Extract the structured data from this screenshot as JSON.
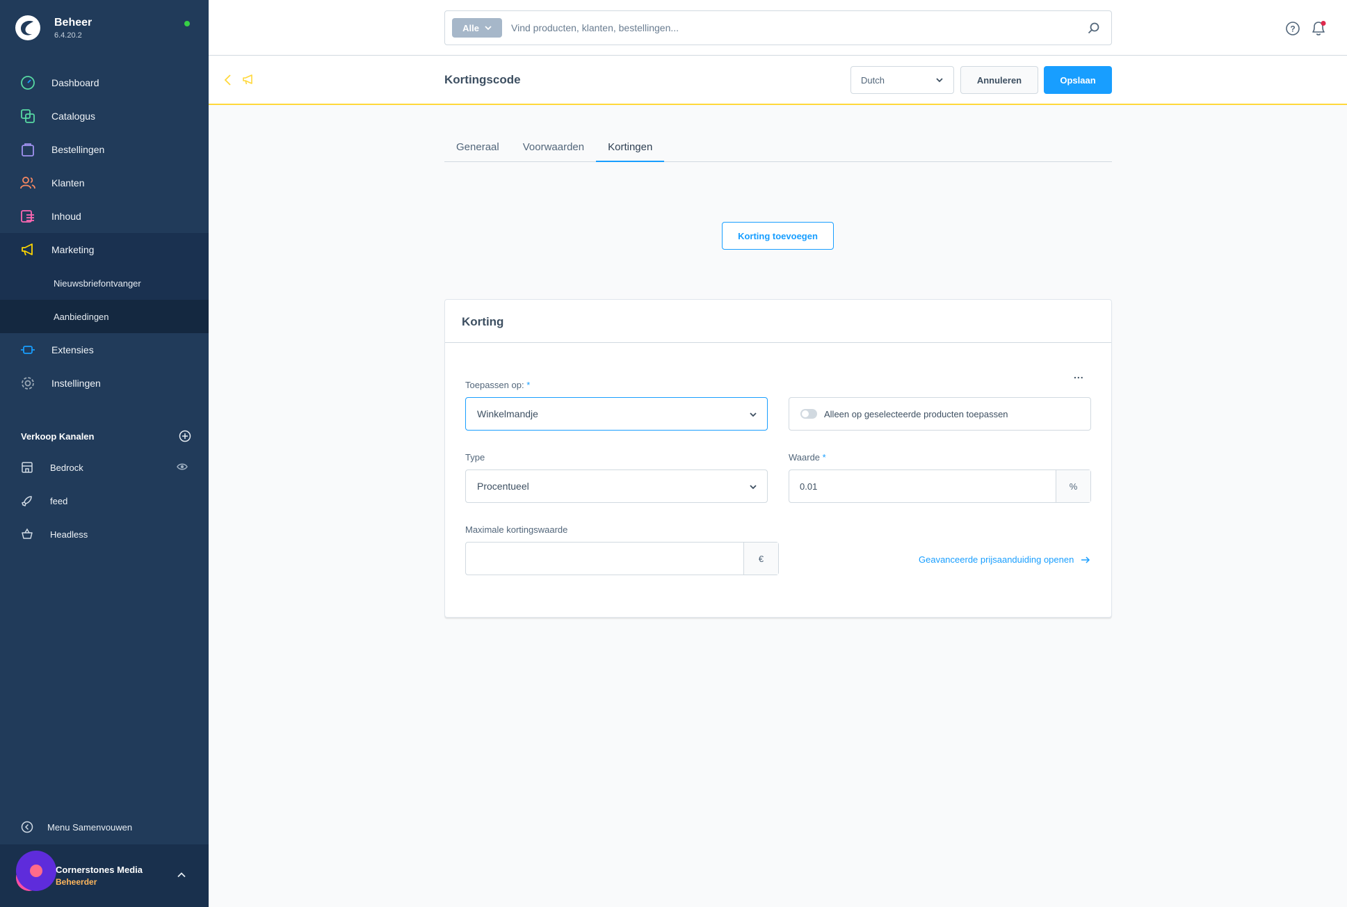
{
  "app": {
    "name": "Beheer",
    "version": "6.4.20.2"
  },
  "sidebar": {
    "items": [
      {
        "label": "Dashboard",
        "icon": "dashboard-icon",
        "color": "#57d9a3"
      },
      {
        "label": "Catalogus",
        "icon": "catalogue-icon",
        "color": "#57d9a3"
      },
      {
        "label": "Bestellingen",
        "icon": "orders-icon",
        "color": "#a092f0"
      },
      {
        "label": "Klanten",
        "icon": "customers-icon",
        "color": "#f88962"
      },
      {
        "label": "Inhoud",
        "icon": "content-icon",
        "color": "#ff68b4"
      },
      {
        "label": "Marketing",
        "icon": "marketing-icon",
        "color": "#ffd700"
      }
    ],
    "sub_items": [
      {
        "label": "Nieuwsbriefontvanger"
      },
      {
        "label": "Aanbiedingen"
      }
    ],
    "bottom_items": [
      {
        "label": "Extensies",
        "icon": "extensions-icon",
        "color": "#189eff"
      },
      {
        "label": "Instellingen",
        "icon": "settings-icon",
        "color": "#9aa8b5"
      }
    ],
    "sales_channels_title": "Verkoop Kanalen",
    "sales_channels": [
      {
        "label": "Bedrock",
        "icon": "storefront-icon"
      },
      {
        "label": "feed",
        "icon": "rocket-icon"
      },
      {
        "label": "Headless",
        "icon": "basket-icon"
      }
    ],
    "collapse_label": "Menu Samenvouwen",
    "user": {
      "name": "Cornerstones Media",
      "role": "Beheerder"
    }
  },
  "search": {
    "type_label": "Alle",
    "placeholder": "Vind producten, klanten, bestellingen..."
  },
  "smartbar": {
    "title": "Kortingscode",
    "language": "Dutch",
    "cancel_label": "Annuleren",
    "save_label": "Opslaan"
  },
  "tabs": [
    {
      "label": "Generaal"
    },
    {
      "label": "Voorwaarden"
    },
    {
      "label": "Kortingen",
      "active": true
    }
  ],
  "add_discount_label": "Korting toevoegen",
  "discount_card": {
    "title": "Korting",
    "menu_label": "...",
    "apply_to_label": "Toepassen op:",
    "apply_to_value": "Winkelmandje",
    "only_selected_label": "Alleen op geselecteerde producten toepassen",
    "only_selected_enabled": false,
    "type_label": "Type",
    "type_value": "Procentueel",
    "value_label": "Waarde",
    "value_value": "0.01",
    "value_suffix": "%",
    "max_label": "Maximale kortingswaarde",
    "max_value": "",
    "max_suffix": "€",
    "advanced_link": "Geavanceerde prijsaanduiding openen",
    "required_mark": "*"
  },
  "colors": {
    "sidebar_bg": "#213b5a",
    "accent": "#189eff",
    "smartbar_border": "#ffd83b",
    "role": "#ffb75d"
  }
}
